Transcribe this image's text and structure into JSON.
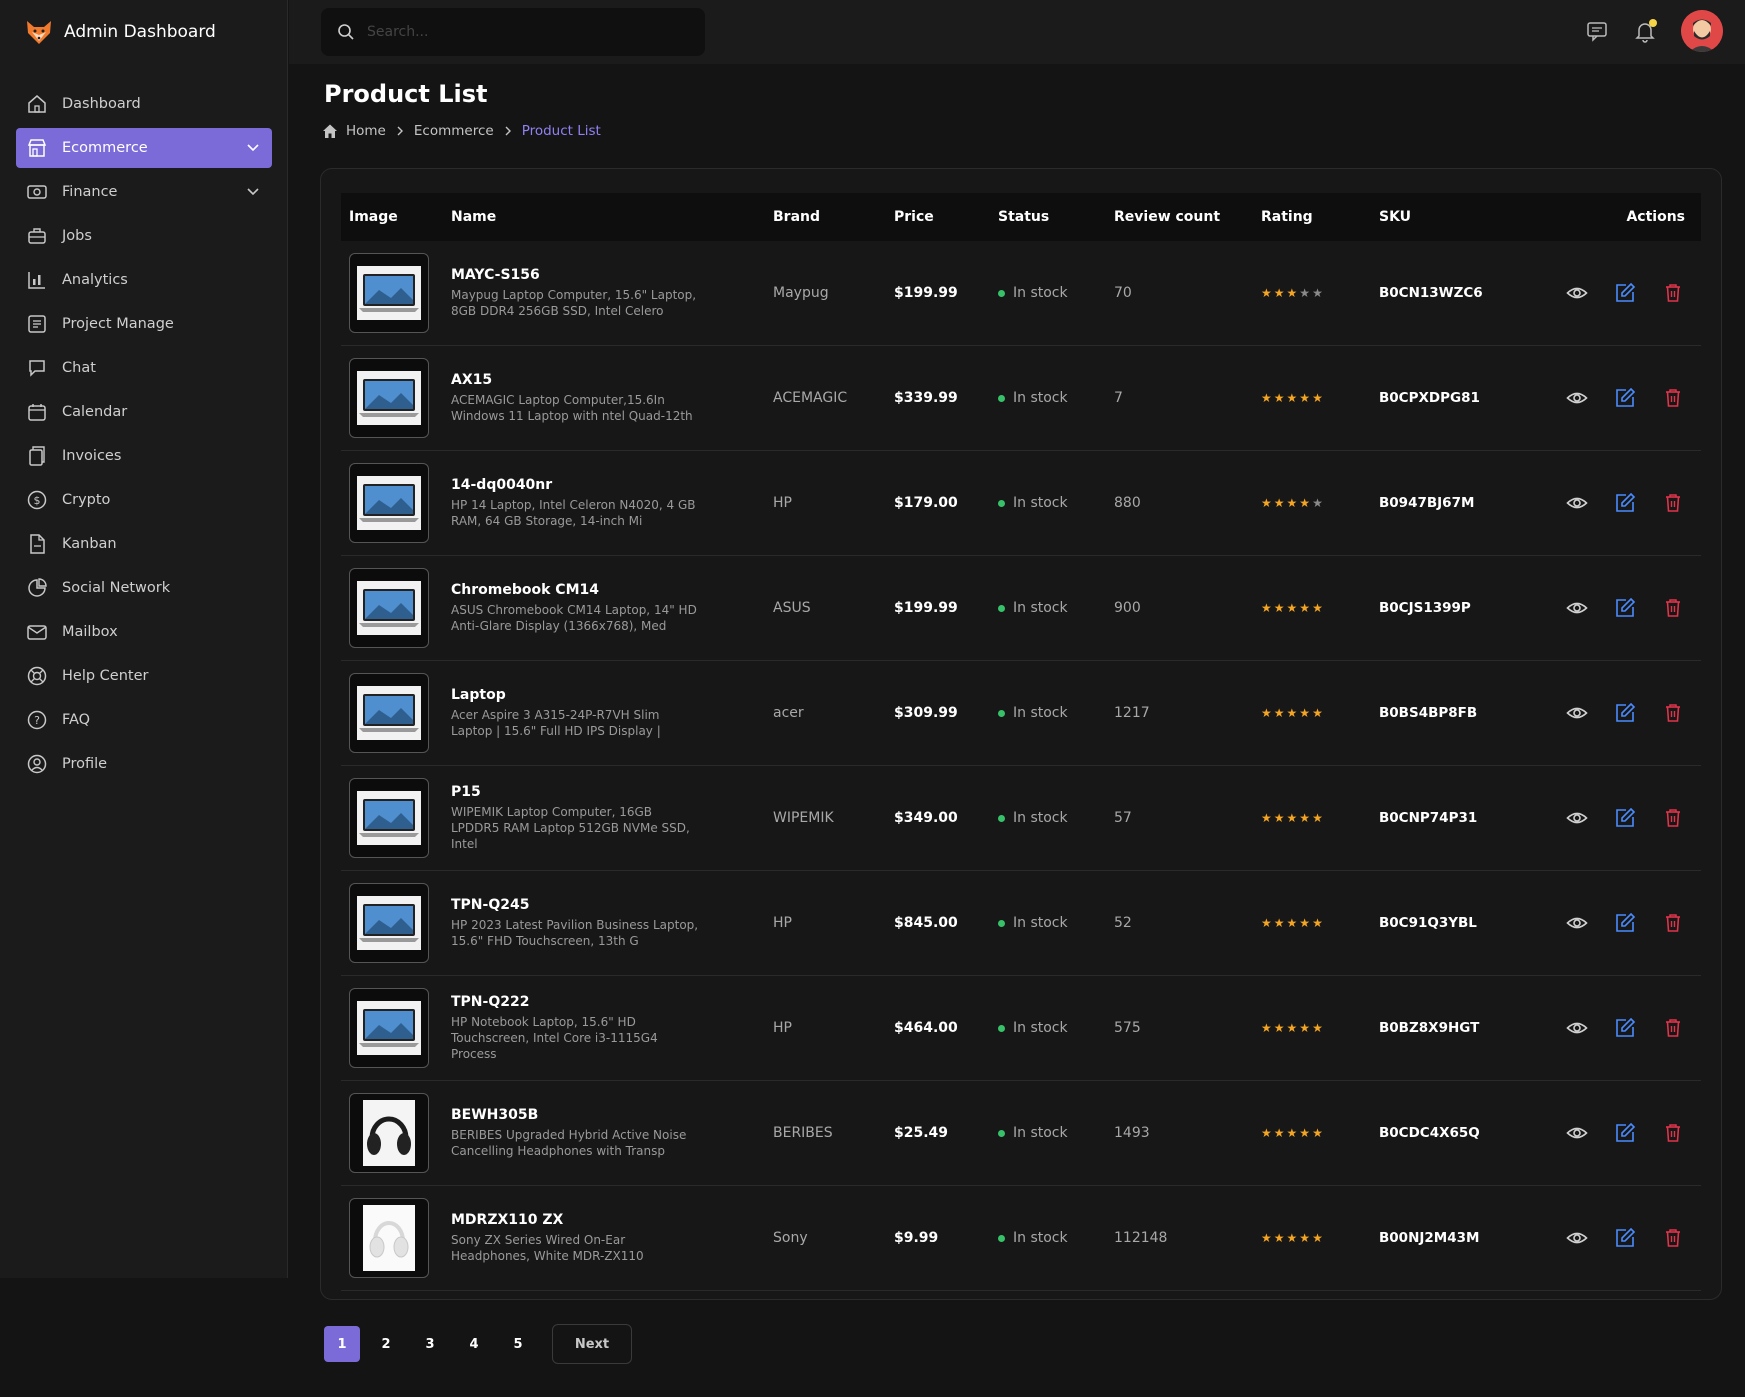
{
  "app": {
    "title": "Admin Dashboard"
  },
  "search": {
    "placeholder": "Search..."
  },
  "sidebar": {
    "items": [
      {
        "label": "Dashboard",
        "icon": "home-icon"
      },
      {
        "label": "Ecommerce",
        "icon": "store-icon",
        "active": true,
        "expandable": true
      },
      {
        "label": "Finance",
        "icon": "finance-icon",
        "expandable": true
      },
      {
        "label": "Jobs",
        "icon": "briefcase-icon"
      },
      {
        "label": "Analytics",
        "icon": "analytics-icon"
      },
      {
        "label": "Project Manage",
        "icon": "project-icon"
      },
      {
        "label": "Chat",
        "icon": "chat-icon"
      },
      {
        "label": "Calendar",
        "icon": "calendar-icon"
      },
      {
        "label": "Invoices",
        "icon": "invoices-icon"
      },
      {
        "label": "Crypto",
        "icon": "dollar-icon"
      },
      {
        "label": "Kanban",
        "icon": "kanban-icon"
      },
      {
        "label": "Social Network",
        "icon": "social-icon"
      },
      {
        "label": "Mailbox",
        "icon": "mail-icon"
      },
      {
        "label": "Help Center",
        "icon": "lifebuoy-icon"
      },
      {
        "label": "FAQ",
        "icon": "question-icon"
      },
      {
        "label": "Profile",
        "icon": "user-icon"
      }
    ]
  },
  "page": {
    "title": "Product List",
    "breadcrumb": [
      "Home",
      "Ecommerce",
      "Product List"
    ]
  },
  "table": {
    "headers": [
      "Image",
      "Name",
      "Brand",
      "Price",
      "Status",
      "Review count",
      "Rating",
      "SKU",
      "Actions"
    ],
    "rows": [
      {
        "name": "MAYC-S156",
        "desc": "Maypug Laptop Computer, 15.6\" Laptop, 8GB DDR4 256GB SSD, Intel Celero",
        "brand": "Maypug",
        "price": "$199.99",
        "status": "In stock",
        "reviews": "70",
        "rating": 3,
        "sku": "B0CN13WZC6",
        "thumb": "laptop"
      },
      {
        "name": "AX15",
        "desc": "ACEMAGIC Laptop Computer,15.6In Windows 11 Laptop with ntel Quad-12th",
        "brand": "ACEMAGIC",
        "price": "$339.99",
        "status": "In stock",
        "reviews": "7",
        "rating": 5,
        "sku": "B0CPXDPG81",
        "thumb": "laptop"
      },
      {
        "name": "14-dq0040nr",
        "desc": "HP 14 Laptop, Intel Celeron N4020, 4 GB RAM, 64 GB Storage, 14-inch Mi",
        "brand": "HP",
        "price": "$179.00",
        "status": "In stock",
        "reviews": "880",
        "rating": 4,
        "sku": "B0947BJ67M",
        "thumb": "laptop"
      },
      {
        "name": "Chromebook CM14",
        "desc": "ASUS Chromebook CM14 Laptop, 14\" HD Anti-Glare Display (1366x768), Med",
        "brand": "ASUS",
        "price": "$199.99",
        "status": "In stock",
        "reviews": "900",
        "rating": 5,
        "sku": "B0CJS1399P",
        "thumb": "laptop"
      },
      {
        "name": "Laptop",
        "desc": "Acer Aspire 3 A315-24P-R7VH Slim Laptop | 15.6\" Full HD IPS Display |",
        "brand": "acer",
        "price": "$309.99",
        "status": "In stock",
        "reviews": "1217",
        "rating": 5,
        "sku": "B0BS4BP8FB",
        "thumb": "laptop"
      },
      {
        "name": "P15",
        "desc": "WIPEMIK Laptop Computer, 16GB LPDDR5 RAM Laptop 512GB NVMe SSD, Intel",
        "brand": "WIPEMIK",
        "price": "$349.00",
        "status": "In stock",
        "reviews": "57",
        "rating": 5,
        "sku": "B0CNP74P31",
        "thumb": "laptop"
      },
      {
        "name": "TPN-Q245",
        "desc": "HP 2023 Latest Pavilion Business Laptop, 15.6\" FHD Touchscreen, 13th G",
        "brand": "HP",
        "price": "$845.00",
        "status": "In stock",
        "reviews": "52",
        "rating": 5,
        "sku": "B0C91Q3YBL",
        "thumb": "laptop"
      },
      {
        "name": "TPN-Q222",
        "desc": "HP Notebook Laptop, 15.6\" HD Touchscreen, Intel Core i3-1115G4 Process",
        "brand": "HP",
        "price": "$464.00",
        "status": "In stock",
        "reviews": "575",
        "rating": 5,
        "sku": "B0BZ8X9HGT",
        "thumb": "laptop"
      },
      {
        "name": "BEWH305B",
        "desc": "BERIBES Upgraded Hybrid Active Noise Cancelling Headphones with Transp",
        "brand": "BERIBES",
        "price": "$25.49",
        "status": "In stock",
        "reviews": "1493",
        "rating": 5,
        "sku": "B0CDC4X65Q",
        "thumb": "headphones-dark"
      },
      {
        "name": "MDRZX110 ZX",
        "desc": "Sony ZX Series Wired On-Ear Headphones, White MDR-ZX110",
        "brand": "Sony",
        "price": "$9.99",
        "status": "In stock",
        "reviews": "112148",
        "rating": 5,
        "sku": "B00NJ2M43M",
        "thumb": "headphones-white"
      }
    ]
  },
  "pagination": {
    "pages": [
      "1",
      "2",
      "3",
      "4",
      "5"
    ],
    "current": "1",
    "next_label": "Next"
  },
  "colors": {
    "accent": "#7b6bd9",
    "star": "#f5a524",
    "star_empty": "#8a8a8a",
    "status_ok": "#37c26a",
    "edit": "#4a8cff",
    "delete": "#e0344a"
  }
}
